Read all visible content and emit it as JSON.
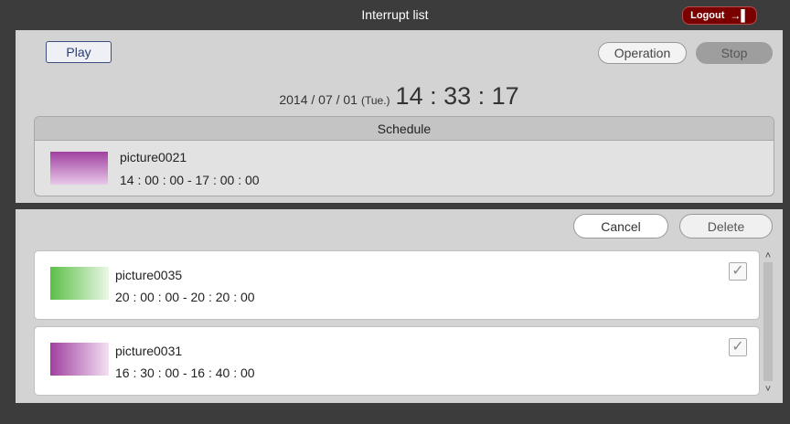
{
  "header": {
    "title": "Interrupt list",
    "logout_label": "Logout"
  },
  "controls": {
    "play_label": "Play",
    "operation_label": "Operation",
    "stop_label": "Stop"
  },
  "clock": {
    "date": "2014 / 07 / 01",
    "weekday": "(Tue.)",
    "time": "14 : 33 : 17"
  },
  "schedule": {
    "header": "Schedule",
    "item": {
      "name": "picture0021",
      "time": "14 : 00 : 00 - 17 : 00 : 00",
      "thumb_color": "#a040a0"
    }
  },
  "list_controls": {
    "cancel_label": "Cancel",
    "delete_label": "Delete"
  },
  "interrupts": [
    {
      "name": "picture0035",
      "time": "20 : 00 : 00 - 20 : 20 : 00",
      "checked": true,
      "thumb_color": "#5cbf46"
    },
    {
      "name": "picture0031",
      "time": "16 : 30 : 00 - 16 : 40 : 00",
      "checked": true,
      "thumb_color": "#a040a0"
    }
  ],
  "colors": {
    "logout_bg": "#7a0000",
    "panel_bg": "#d3d3d3",
    "frame_bg": "#3c3c3c"
  }
}
